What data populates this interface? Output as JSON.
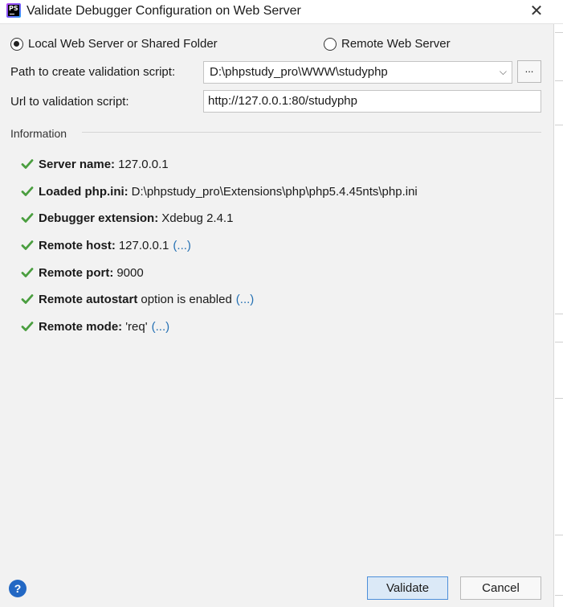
{
  "window": {
    "title": "Validate Debugger Configuration on Web Server",
    "app_icon_text": "PS",
    "close_glyph": "✕"
  },
  "options": {
    "local_label": "Local Web Server or Shared Folder",
    "remote_label": "Remote Web Server",
    "selected": "local"
  },
  "path_field": {
    "label": "Path to create validation script:",
    "value": "D:\\phpstudy_pro\\WWW\\studyphp",
    "browse_label": "..."
  },
  "url_field": {
    "label": "Url to validation script:",
    "value": "http://127.0.0.1:80/studyphp"
  },
  "information": {
    "title": "Information",
    "check_color": "#4a9e3f",
    "items": [
      {
        "key": "Server name:",
        "value": "127.0.0.1",
        "link": ""
      },
      {
        "key": "Loaded php.ini:",
        "value": "D:\\phpstudy_pro\\Extensions\\php\\php5.4.45nts\\php.ini",
        "link": ""
      },
      {
        "key": "Debugger extension:",
        "value": "Xdebug 2.4.1",
        "link": ""
      },
      {
        "key": "Remote host:",
        "value": "127.0.0.1",
        "link": "(...)"
      },
      {
        "key": "Remote port:",
        "value": "9000",
        "link": ""
      },
      {
        "key": "Remote autostart",
        "value": "option is enabled",
        "link": "(...)"
      },
      {
        "key": "Remote mode:",
        "value": "'req'",
        "link": "(...)"
      }
    ]
  },
  "footer": {
    "help_glyph": "?",
    "validate_label": "Validate",
    "cancel_label": "Cancel"
  }
}
